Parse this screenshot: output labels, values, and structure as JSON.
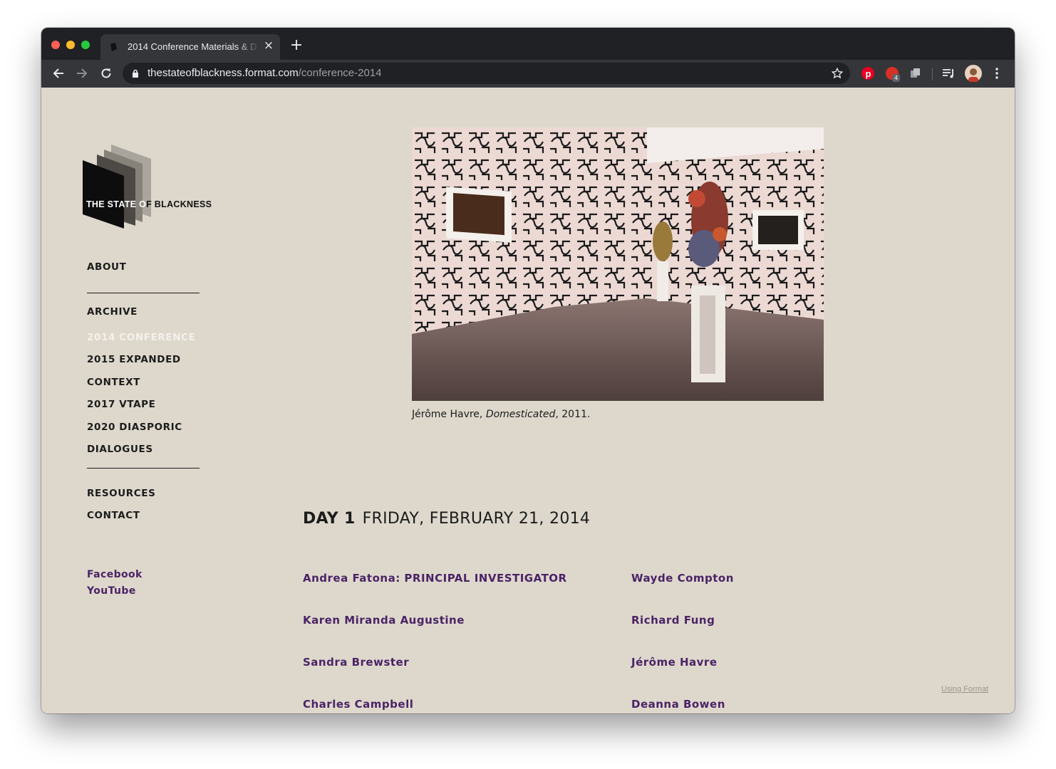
{
  "browser": {
    "tab_title": "2014 Conference Materials & D",
    "url_host": "thestateofblackness.format.com",
    "url_path": "/conference-2014",
    "extension_badge": "4"
  },
  "site": {
    "logo_text_left": "THE STATE O",
    "logo_text_right": "F BLACKNESS",
    "nav_primary": [
      "ABOUT"
    ],
    "nav_archive": [
      "ARCHIVE",
      "2014 CONFERENCE",
      "2015 EXPANDED",
      "CONTEXT",
      "2017 VTAPE",
      "2020 DIASPORIC",
      "DIALOGUES"
    ],
    "nav_secondary": [
      "RESOURCES",
      "CONTACT"
    ],
    "social": [
      "Facebook",
      "YouTube"
    ]
  },
  "main": {
    "caption_artist": "Jérôme Havre, ",
    "caption_title": "Domesticated",
    "caption_year": ", 2011.",
    "day_label": "DAY 1",
    "day_date": "FRIDAY, FEBRUARY 21, 2014",
    "speakers_left": [
      "Andrea Fatona: PRINCIPAL INVESTIGATOR",
      "Karen Miranda Augustine",
      "Sandra Brewster",
      "Charles Campbell"
    ],
    "speakers_right": [
      "Wayde Compton",
      "Richard Fung",
      "Jérôme Havre",
      "Deanna Bowen"
    ],
    "footer_link": "Using Format"
  },
  "colors": {
    "page_bg": "#ded8cc",
    "link_purple": "#4a2366",
    "active_nav": "#f4f1ea"
  }
}
